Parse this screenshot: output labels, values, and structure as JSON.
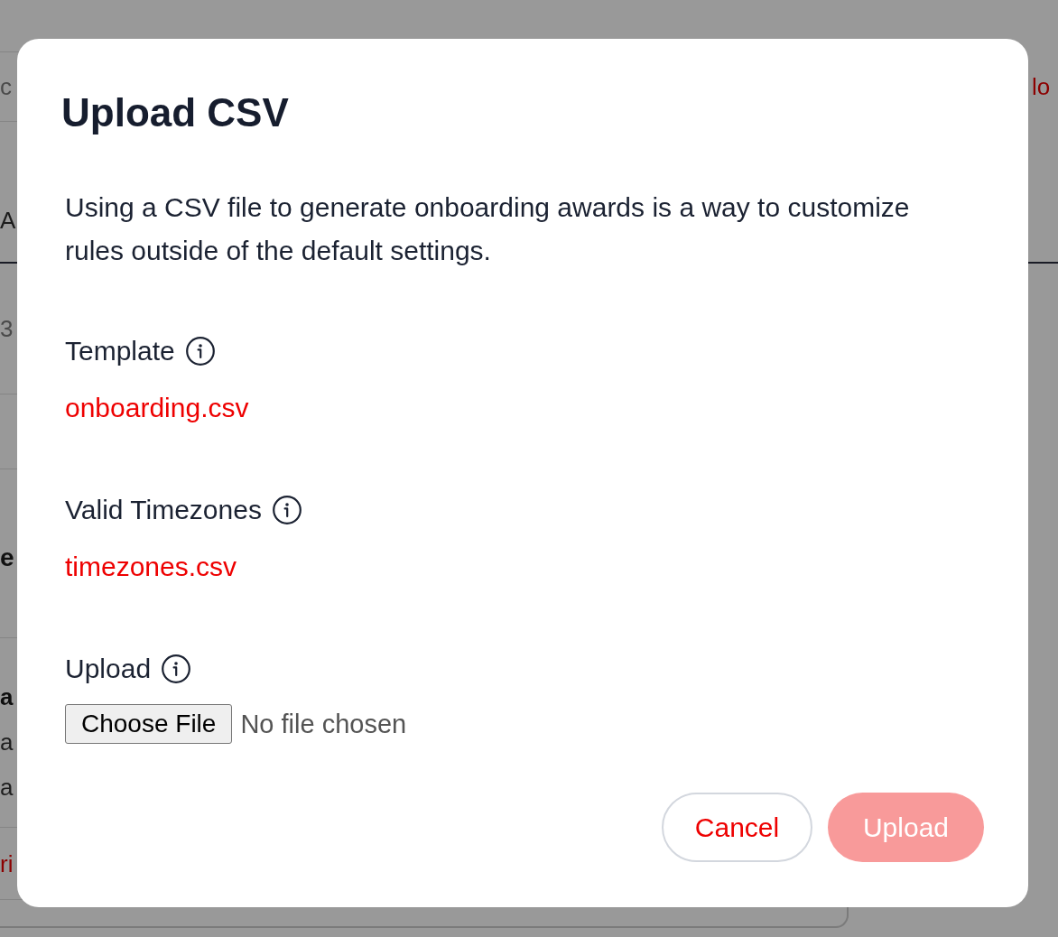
{
  "background": {
    "search_text": "c",
    "header_link": "lo",
    "tab_label": "A",
    "row_value": "3",
    "section_heading": "e",
    "section_lines": [
      {
        "text": "a",
        "bold": true
      },
      {
        "text": "a",
        "bold": false
      },
      {
        "text": "a",
        "bold": false
      }
    ],
    "footer_link": "ri"
  },
  "dialog": {
    "title": "Upload CSV",
    "description": "Using a CSV file to generate onboarding awards is a way to customize rules outside of the default settings.",
    "fields": [
      {
        "kind": "link",
        "label": "Template",
        "link": "onboarding.csv"
      },
      {
        "kind": "link",
        "label": "Valid Timezones",
        "link": "timezones.csv"
      },
      {
        "kind": "file",
        "label": "Upload",
        "button": "Choose File",
        "status": "No file chosen"
      }
    ],
    "buttons": [
      {
        "kind": "secondary",
        "label": "Cancel",
        "disabled": false
      },
      {
        "kind": "primary",
        "label": "Upload",
        "disabled": true
      }
    ]
  }
}
